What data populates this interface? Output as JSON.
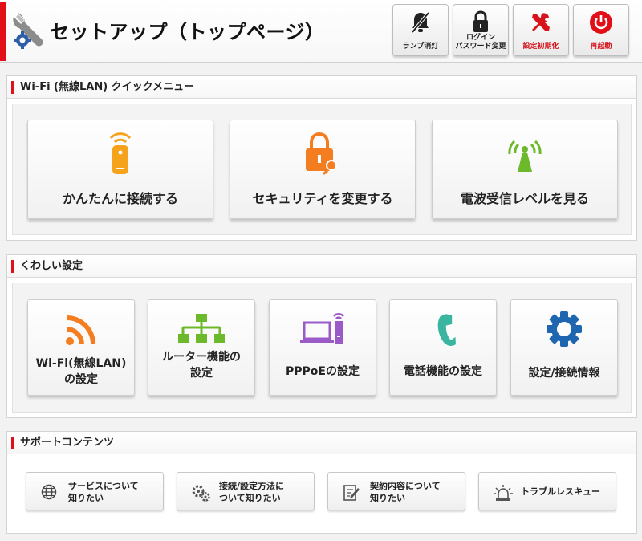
{
  "header": {
    "title": "セットアップ（トップページ）",
    "buttons": [
      {
        "label": "ランプ消灯",
        "icon": "lamp-off-icon"
      },
      {
        "label": "ログイン\nパスワード変更",
        "icon": "lock-icon"
      },
      {
        "label": "設定初期化",
        "icon": "tools-icon"
      },
      {
        "label": "再起動",
        "icon": "power-icon"
      }
    ]
  },
  "quick_menu": {
    "title": "Wi-Fi (無線LAN) クイックメニュー",
    "items": [
      {
        "label": "かんたんに接続する",
        "icon": "wps-device-icon"
      },
      {
        "label": "セキュリティを変更する",
        "icon": "lock-key-icon"
      },
      {
        "label": "電波受信レベルを見る",
        "icon": "signal-tower-icon"
      }
    ]
  },
  "detail": {
    "title": "くわしい設定",
    "items": [
      {
        "label_line1": "Wi-Fi(無線LAN)",
        "label_line2": "の設定",
        "icon": "wifi-icon"
      },
      {
        "label_line1": "ルーター機能の",
        "label_line2": "設定",
        "icon": "network-tree-icon"
      },
      {
        "label_line1": "PPPoEの設定",
        "label_line2": "",
        "icon": "pc-router-icon"
      },
      {
        "label_line1": "電話機能の設定",
        "label_line2": "",
        "icon": "phone-icon"
      },
      {
        "label_line1": "設定/接続情報",
        "label_line2": "",
        "icon": "gear-icon"
      }
    ]
  },
  "support": {
    "title": "サポートコンテンツ",
    "items": [
      {
        "label": "サービスについて\n知りたい",
        "icon": "globe-icon"
      },
      {
        "label": "接続/設定方法に\nついて知りたい",
        "icon": "gears-icon"
      },
      {
        "label": "契約内容について\n知りたい",
        "icon": "document-pen-icon"
      },
      {
        "label": "トラブルレスキュー",
        "icon": "alarm-light-icon"
      }
    ]
  },
  "colors": {
    "accent_red": "#e20f18",
    "orange": "#f47d20",
    "green": "#6cb92c",
    "purple": "#9a5bc8",
    "teal": "#3ab6a0",
    "blue": "#1f66b0"
  }
}
